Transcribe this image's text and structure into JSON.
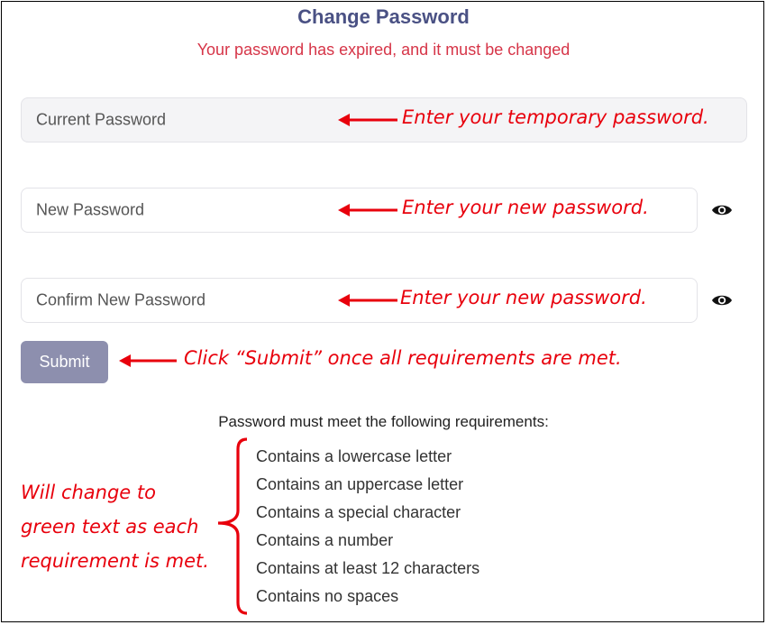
{
  "form": {
    "title": "Change Password",
    "subtitle": "Your password has expired, and it must be changed",
    "current_placeholder": "Current Password",
    "new_placeholder": "New Password",
    "confirm_placeholder": "Confirm New Password",
    "submit_label": "Submit",
    "requirements_title": "Password must meet the following requirements:",
    "requirements": [
      "Contains a lowercase letter",
      "Contains an uppercase letter",
      "Contains a special character",
      "Contains a number",
      "Contains at least 12 characters",
      "Contains no spaces"
    ]
  },
  "annotations": {
    "current": "Enter your temporary password.",
    "new": "Enter your new password.",
    "confirm": "Enter your new password.",
    "submit": "Click “Submit” once all requirements are met.",
    "requirements_note": [
      "Will change to",
      "green text as each",
      "requirement is met."
    ]
  },
  "icons": {
    "show_password": "eye-icon",
    "arrow": "left-arrow-icon",
    "brace": "left-brace-icon"
  },
  "colors": {
    "title": "#4a5184",
    "error": "#d63548",
    "annotation": "#e8000c",
    "submit_bg": "#8d8fae"
  }
}
